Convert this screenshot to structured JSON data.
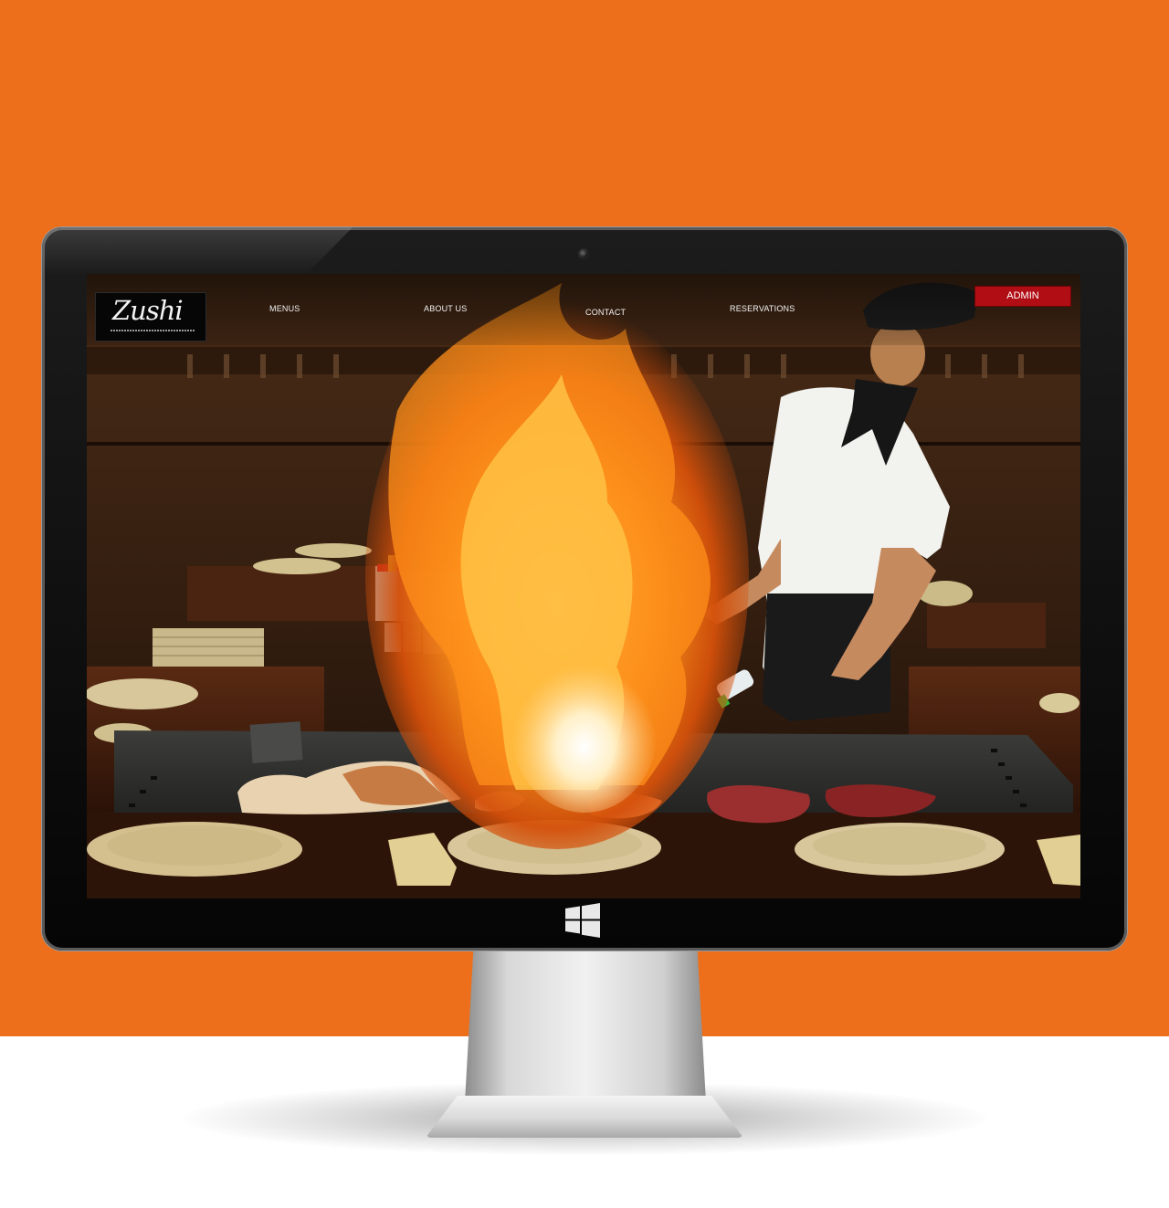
{
  "website": {
    "logo_text": "Zushi",
    "nav": {
      "menus": "MENUS",
      "about": "ABOUT US",
      "contact": "CONTACT",
      "reservations": "RESERVATIONS",
      "admin": "ADMIN"
    }
  },
  "icons": {
    "monitor_brand": "windows-logo-icon"
  },
  "colors": {
    "background": "#ee6f1b",
    "admin_button": "#b00e14"
  }
}
